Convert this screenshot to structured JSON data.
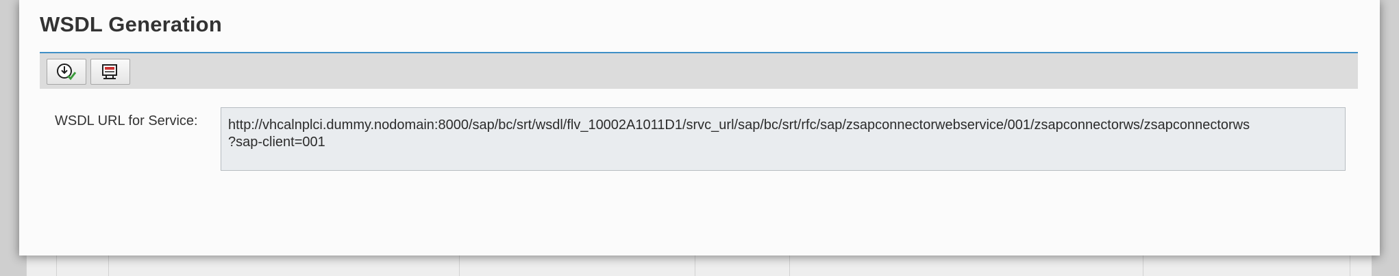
{
  "dialog": {
    "title": "WSDL Generation",
    "accent_color": "#3f8fc6"
  },
  "toolbar": {
    "buttons": [
      {
        "icon": "download-icon"
      },
      {
        "icon": "display-icon"
      }
    ]
  },
  "field": {
    "label": "WSDL URL for Service:",
    "value_line1": "http://vhcalnplci.dummy.nodomain:8000/sap/bc/srt/wsdl/flv_10002A1011D1/srvc_url/sap/bc/srt/rfc/sap/zsapconnectorwebservice/001/zsapconnectorws/zsapconnectorws",
    "value_line2": "?sap-client=001"
  }
}
